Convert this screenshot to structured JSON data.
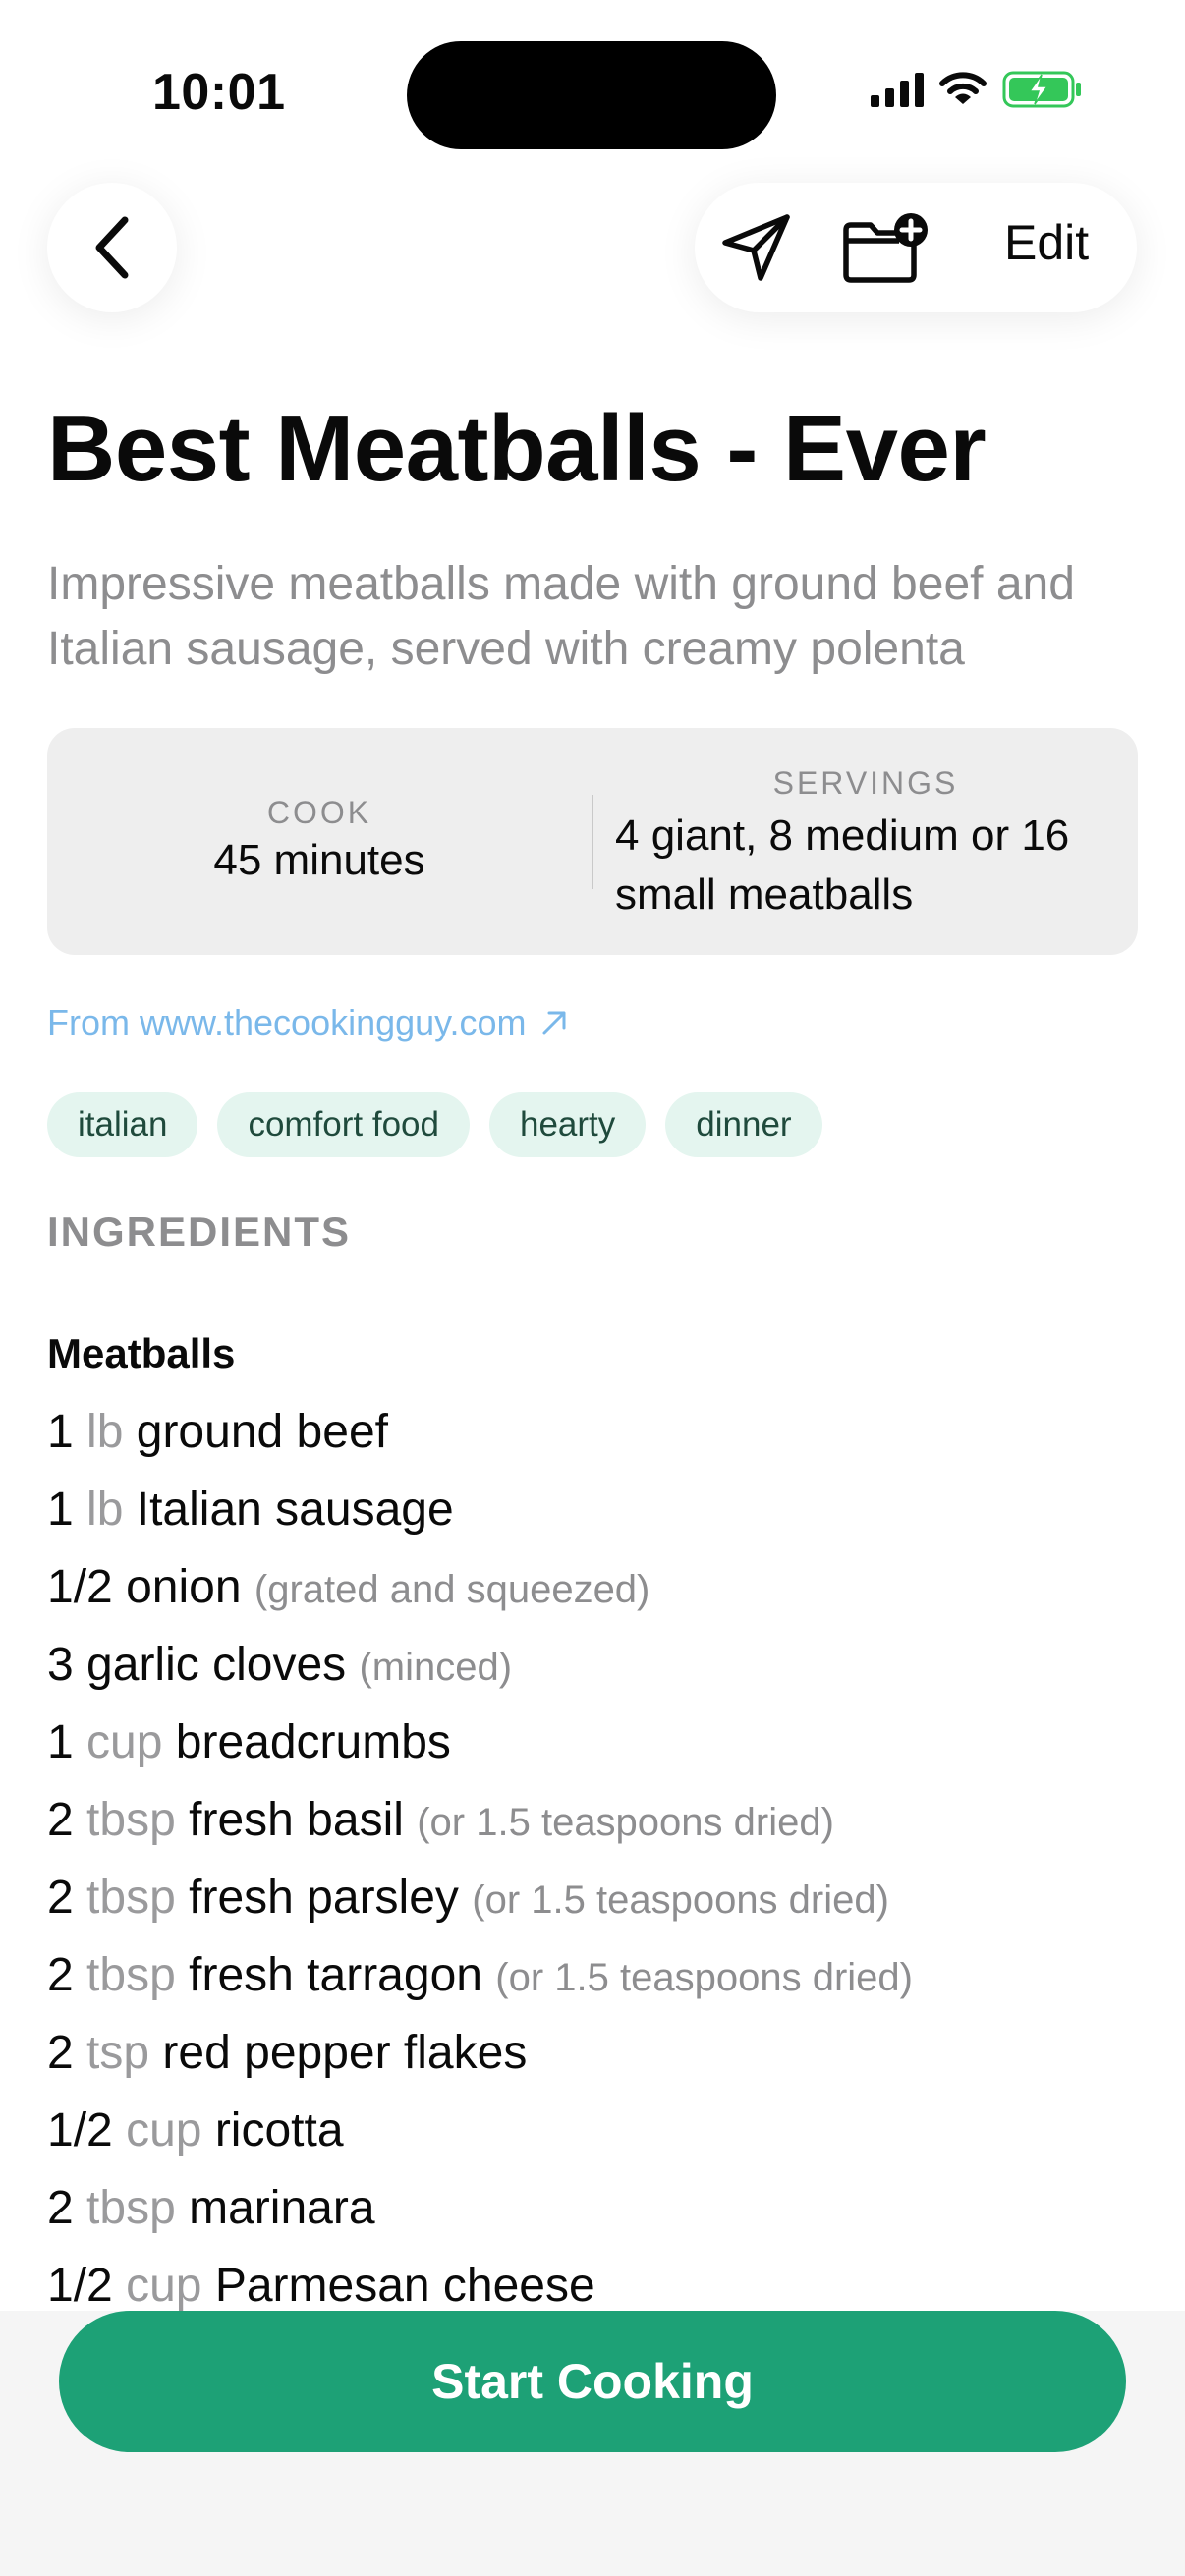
{
  "status_bar": {
    "time": "10:01",
    "icons": [
      "signal-icon",
      "wifi-icon",
      "battery-charging-icon"
    ],
    "battery_color": "#34c759"
  },
  "header": {
    "back_icon": "chevron-left-icon",
    "share_icon": "send-icon",
    "save_icon": "folder-plus-icon",
    "edit_label": "Edit"
  },
  "recipe": {
    "title": "Best Meatballs - Ever",
    "description": "Impressive meatballs made with ground beef and Italian sausage, served with creamy polenta",
    "cook_label": "COOK",
    "cook_value": "45 minutes",
    "servings_label": "SERVINGS",
    "servings_value": "4 giant, 8 medium or 16 small meatballs",
    "source": "From www.thecookingguy.com",
    "source_icon": "arrow-up-right-icon",
    "tags": [
      "italian",
      "comfort food",
      "hearty",
      "dinner"
    ]
  },
  "ingredients": {
    "section_label": "INGREDIENTS",
    "group_name": "Meatballs",
    "items": [
      {
        "qty": "1",
        "unit": "lb",
        "name": "ground beef",
        "note": ""
      },
      {
        "qty": "1",
        "unit": "lb",
        "name": "Italian sausage",
        "note": ""
      },
      {
        "qty": "1/2",
        "unit": "",
        "name": "onion",
        "note": "(grated and squeezed)"
      },
      {
        "qty": "3",
        "unit": "",
        "name": "garlic cloves",
        "note": "(minced)"
      },
      {
        "qty": "1",
        "unit": "cup",
        "name": "breadcrumbs",
        "note": ""
      },
      {
        "qty": "2",
        "unit": "tbsp",
        "name": "fresh basil",
        "note": "(or 1.5 teaspoons dried)"
      },
      {
        "qty": "2",
        "unit": "tbsp",
        "name": "fresh parsley",
        "note": "(or 1.5 teaspoons dried)"
      },
      {
        "qty": "2",
        "unit": "tbsp",
        "name": "fresh tarragon",
        "note": "(or 1.5 teaspoons dried)"
      },
      {
        "qty": "2",
        "unit": "tsp",
        "name": "red pepper flakes",
        "note": ""
      },
      {
        "qty": "1/2",
        "unit": "cup",
        "name": "ricotta",
        "note": ""
      },
      {
        "qty": "2",
        "unit": "tbsp",
        "name": "marinara",
        "note": ""
      },
      {
        "qty": "1/2",
        "unit": "cup",
        "name": "Parmesan cheese",
        "note": ""
      }
    ]
  },
  "footer": {
    "start_label": "Start Cooking",
    "accent": "#1da176"
  }
}
